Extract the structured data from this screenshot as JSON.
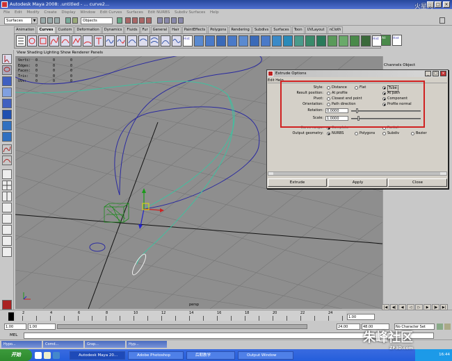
{
  "window": {
    "title": "Autodesk Maya 2008: .untitled - ... curve2...",
    "min": "_",
    "max": "□",
    "close": "×"
  },
  "menubar": [
    "File",
    "Edit",
    "Modify",
    "Create",
    "Display",
    "Window",
    "Edit Curves",
    "Surfaces",
    "Edit NURBS",
    "Subdiv Surfaces",
    "Help"
  ],
  "status": {
    "menu_set": "Surfaces",
    "select_field": "Objects"
  },
  "shelf_tabs": [
    "Animation",
    "Curves",
    "Custom",
    "Deformation",
    "Dynamics",
    "Fluids",
    "Fur",
    "General",
    "Hair",
    "PaintEffects",
    "Polygons",
    "Rendering",
    "Subdivs",
    "Surfaces",
    "Toon",
    "UVLayout",
    "nCloth"
  ],
  "active_shelf_tab": "Curves",
  "shelf_icon_labels": [
    "NRB",
    "All",
    "Hist"
  ],
  "viewport": {
    "menu": [
      "View",
      "Shading",
      "Lighting",
      "Show",
      "Renderer",
      "Panels"
    ],
    "hud": [
      {
        "label": "Verts:",
        "v1": "0",
        "v2": "0",
        "v3": "0"
      },
      {
        "label": "Edges:",
        "v1": "0",
        "v2": "0",
        "v3": "0"
      },
      {
        "label": "Faces:",
        "v1": "0",
        "v2": "0",
        "v3": "0"
      },
      {
        "label": "Tris:",
        "v1": "0",
        "v2": "0",
        "v3": "0"
      },
      {
        "label": "UVs:",
        "v1": "0",
        "v2": "0",
        "v3": "0"
      }
    ],
    "camera": "persp"
  },
  "channel_box": {
    "tab1": "Channels",
    "tab2": "Object"
  },
  "dialog": {
    "title": "Extrude Options",
    "menu": [
      "Edit",
      "Help"
    ],
    "rows": [
      {
        "label": "Style:",
        "options": [
          "Distance",
          "Flat",
          "Tube"
        ],
        "selected": 2
      },
      {
        "label": "Result position:",
        "options": [
          "At profile",
          "At path"
        ],
        "selected": 1
      },
      {
        "label": "Pivot:",
        "options": [
          "Closest end point",
          "Component"
        ],
        "selected": 1
      },
      {
        "label": "Orientation:",
        "options": [
          "Path direction",
          "Profile normal"
        ],
        "selected": 1
      }
    ],
    "rotation_label": "Rotation:",
    "rotation_value": "0.0000",
    "scale_label": "Scale:",
    "scale_value": "1.0000",
    "curve_range_label": "Curve range:",
    "curve_range_options": [
      "Complete",
      "Partial"
    ],
    "output_label": "Output geometry:",
    "output_options": [
      "NURBS",
      "Polygons",
      "Subdiv",
      "Bezier"
    ],
    "output_selected": 0,
    "buttons": [
      "Extrude",
      "Apply",
      "Close"
    ]
  },
  "timeline": {
    "ticks": [
      "2",
      "4",
      "6",
      "8",
      "10",
      "12",
      "14",
      "16",
      "18",
      "20",
      "22",
      "24"
    ],
    "current_frame": "1.00",
    "range_start": "1.00",
    "range_inner_start": "1.00",
    "range_end": "24.00",
    "range_outer_end": "48.00",
    "current_field": "1",
    "character_set": "No Character Set"
  },
  "mel_label": "MEL",
  "mini_windows": [
    "Hypo...",
    "Comd...",
    "Grap...",
    "Hyp..."
  ],
  "taskbar": {
    "start": "开始",
    "items": [
      "Autodesk Maya 20...",
      "Adobe Photoshop",
      "后期教学",
      "Output Window"
    ],
    "clock": "16:44"
  },
  "watermark": {
    "site": "朱峰社区",
    "url": "ZF3D.com",
    "top": "火星网 hxsd.com"
  }
}
